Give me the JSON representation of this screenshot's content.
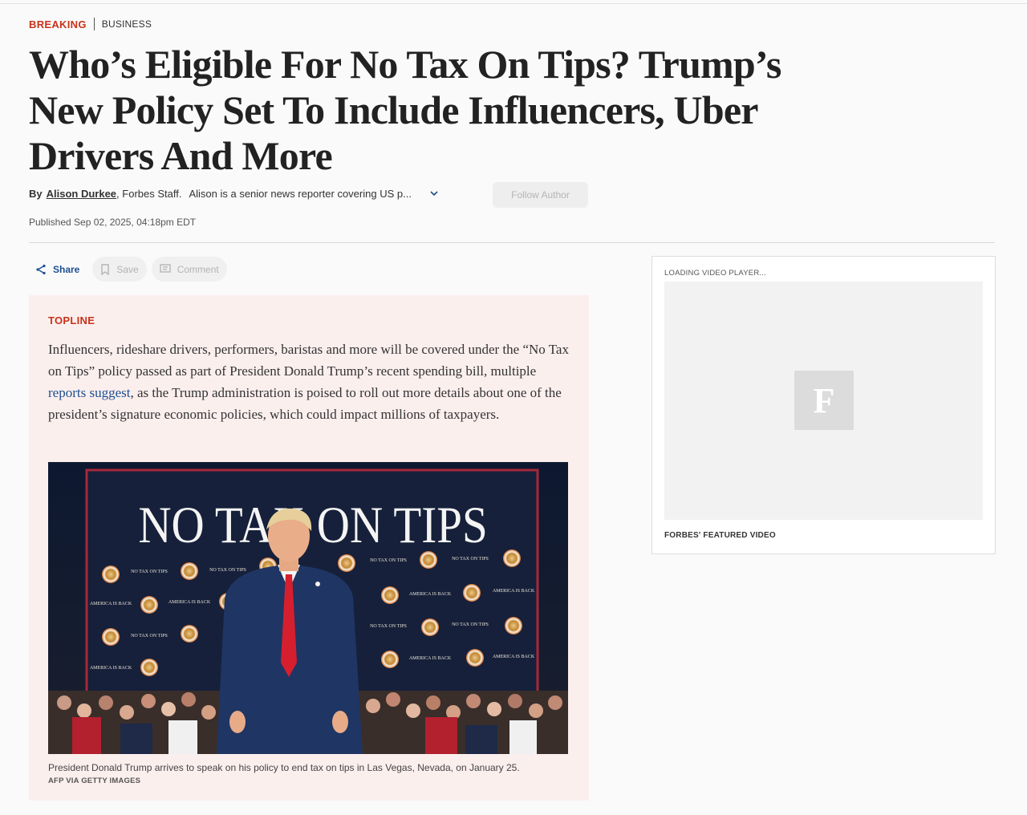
{
  "header": {
    "category_primary": "BREAKING",
    "category_secondary": "BUSINESS",
    "headline": "Who’s Eligible For No Tax On Tips? Trump’s New Policy Set To Include Influencers, Uber Drivers And More"
  },
  "byline": {
    "by": "By",
    "author": "Alison Durkee",
    "staff": ", Forbes Staff.",
    "bio": "Alison is a senior news reporter covering US p...",
    "follow_label": "Follow Author",
    "published": "Published Sep 02, 2025, 04:18pm EDT"
  },
  "actions": {
    "share": "Share",
    "save": "Save",
    "comment": "Comment"
  },
  "topline": {
    "label": "TOPLINE",
    "text_before_link": "Influencers, rideshare drivers, performers, baristas and more will be covered under the “No Tax on Tips” policy passed as part of President Donald Trump’s recent spending bill, multiple ",
    "link_text": "reports suggest",
    "text_after_link": ", as the Trump administration is poised to roll out more details about one of the president’s signature economic policies, which could impact millions of taxpayers."
  },
  "image": {
    "sign_text": "NO TAX ON TIPS",
    "seal_label_1": "NO TAX ON TIPS",
    "seal_label_2": "AMERICA IS BACK",
    "caption": "President Donald Trump arrives to speak on his policy to end tax on tips in Las Vegas, Nevada, on January 25.",
    "credit": "AFP VIA GETTY IMAGES"
  },
  "video": {
    "loading": "LOADING VIDEO PLAYER...",
    "logo_letter": "F",
    "label": "FORBES' FEATURED VIDEO"
  },
  "colors": {
    "breaking_red": "#c8331a",
    "link_blue": "#1d4f91",
    "topline_bg": "#fbefee"
  }
}
